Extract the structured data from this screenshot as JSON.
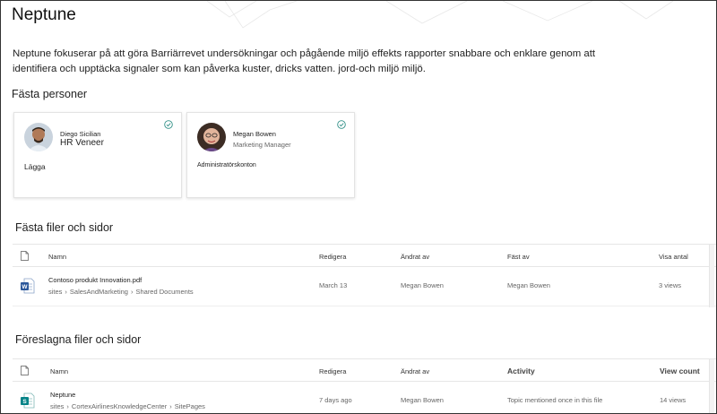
{
  "site": {
    "title": "Neptune",
    "description": "Neptune fokuserar på att göra Barriärrevet undersökningar och pågående miljö effekts rapporter snabbare och enklare genom att identifiera och upptäcka signaler som kan påverka kuster, dricks vatten. jord-och miljö miljö."
  },
  "pinned_people": {
    "heading": "Fästa personer",
    "people": [
      {
        "name": "Diego Sicilian",
        "title": "HR Veneer",
        "description": "Lägga"
      },
      {
        "name": "Megan Bowen",
        "title": "Marketing Manager",
        "description": "Administratörskonton"
      }
    ]
  },
  "pinned_files": {
    "heading": "Fästa filer och sidor",
    "columns": {
      "name": "Namn",
      "edited": "Redigera",
      "modified_by": "Ändrat av",
      "pinned_by": "Fäst av",
      "views": "Visa antal"
    },
    "rows": [
      {
        "name": "Contoso produkt Innovation.pdf",
        "path": [
          "sites",
          "SalesAndMarketing",
          "Shared Documents"
        ],
        "edited": "March 13",
        "modified_by": "Megan Bowen",
        "pinned_by": "Megan Bowen",
        "views": "3 views",
        "icon": "word-doc-icon"
      }
    ]
  },
  "suggested_files": {
    "heading": "Föreslagna filer och sidor",
    "columns": {
      "name": "Namn",
      "edited": "Redigera",
      "modified_by": "Ändrat av",
      "activity": "Activity",
      "views": "View count"
    },
    "rows": [
      {
        "name": "Neptune",
        "path": [
          "sites",
          "CortexAirlinesKnowledgeCenter",
          "SitePages"
        ],
        "edited": "7 days ago",
        "modified_by": "Megan Bowen",
        "activity": "Topic mentioned once in this file",
        "views": "14 views",
        "icon": "sharepoint-page-icon"
      }
    ]
  },
  "colors": {
    "word_blue": "#2b579a",
    "sharepoint_teal": "#038387",
    "check_teal": "#2f8f86"
  }
}
